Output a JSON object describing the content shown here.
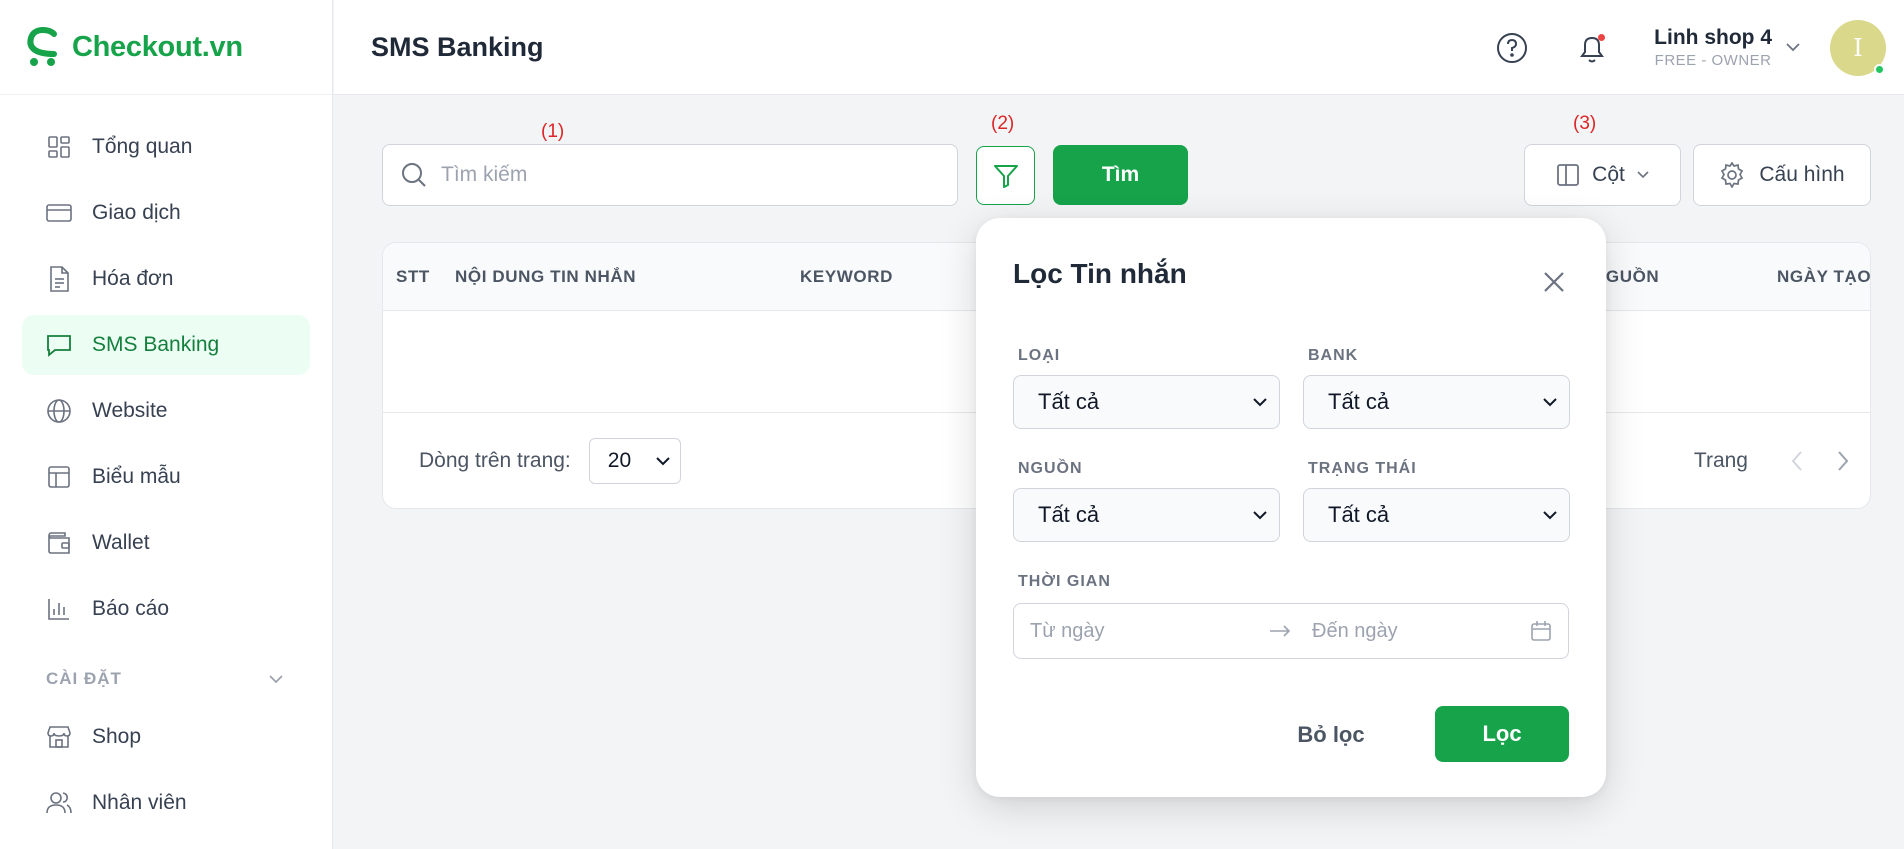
{
  "brand": {
    "name": "Checkout.vn"
  },
  "sidebar": {
    "items": [
      {
        "label": "Tổng quan",
        "icon": "grid-icon"
      },
      {
        "label": "Giao dịch",
        "icon": "credit-card-icon"
      },
      {
        "label": "Hóa đơn",
        "icon": "invoice-icon"
      },
      {
        "label": "SMS Banking",
        "icon": "message-icon",
        "active": true
      },
      {
        "label": "Website",
        "icon": "globe-icon"
      },
      {
        "label": "Biểu mẫu",
        "icon": "layout-icon"
      },
      {
        "label": "Wallet",
        "icon": "wallet-icon"
      },
      {
        "label": "Báo cáo",
        "icon": "bar-chart-icon"
      }
    ],
    "settings_section": "CÀI ĐẶT",
    "settings_items": [
      {
        "label": "Shop",
        "icon": "store-icon"
      },
      {
        "label": "Nhân viên",
        "icon": "users-icon"
      }
    ]
  },
  "header": {
    "title": "SMS Banking",
    "user_name": "Linh shop 4",
    "user_role": "FREE - OWNER",
    "avatar_initial": "I"
  },
  "toolbar": {
    "marker_1": "(1)",
    "marker_2": "(2)",
    "marker_3": "(3)",
    "search_placeholder": "Tìm kiếm",
    "find_label": "Tìm",
    "columns_label": "Cột",
    "config_label": "Cấu hình"
  },
  "table": {
    "headers": [
      "STT",
      "NỘI DUNG TIN NHẮN",
      "KEYWORD",
      "NGUỒN",
      "NGÀY TẠO"
    ],
    "rows_label": "Dòng trên trang:",
    "rows_value": "20",
    "page_label": "Trang"
  },
  "filter": {
    "title": "Lọc Tin nhắn",
    "type_label": "LOẠI",
    "type_value": "Tất cả",
    "bank_label": "BANK",
    "bank_value": "Tất cả",
    "source_label": "NGUỒN",
    "source_value": "Tất cả",
    "status_label": "TRẠNG THÁI",
    "status_value": "Tất cả",
    "time_label": "THỜI GIAN",
    "from_placeholder": "Từ ngày",
    "to_placeholder": "Đến ngày",
    "reset_label": "Bỏ lọc",
    "apply_label": "Lọc"
  },
  "colors": {
    "accent": "#16a34a",
    "marker": "#dc2626"
  }
}
